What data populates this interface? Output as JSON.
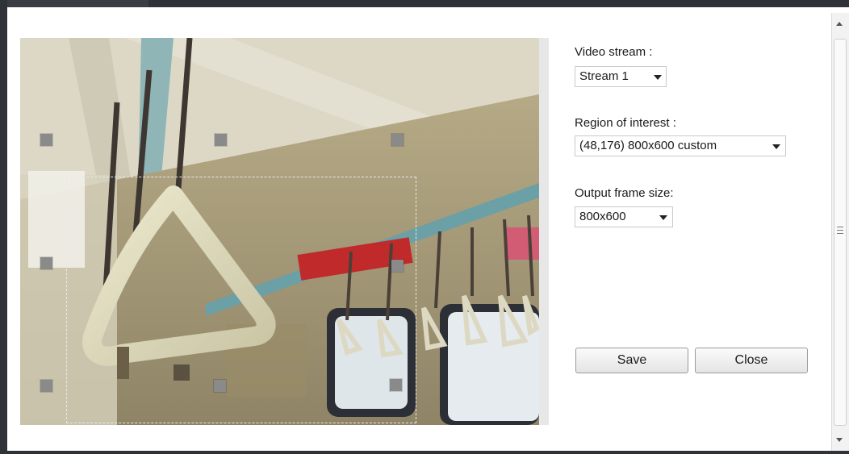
{
  "video_stream": {
    "label": "Video stream :",
    "value": "Stream 1"
  },
  "region_of_interest": {
    "label": "Region of interest :",
    "value": "(48,176) 800x600 custom"
  },
  "output_frame_size": {
    "label": "Output frame size:",
    "value": "800x600"
  },
  "buttons": {
    "save": "Save",
    "close": "Close"
  },
  "icons": {
    "caret": "chevron-down-icon",
    "scroll_up": "scroll-up-arrow-icon",
    "scroll_down": "scroll-down-arrow-icon",
    "scroll_grip": "scroll-grip-icon"
  }
}
